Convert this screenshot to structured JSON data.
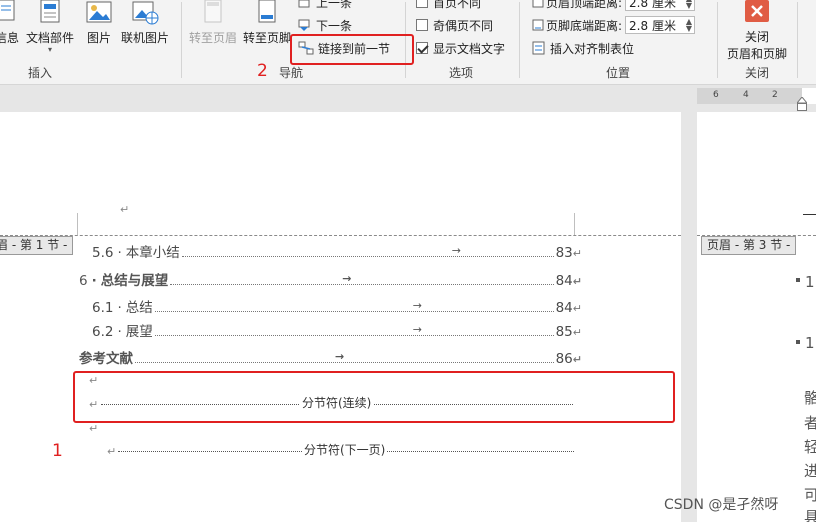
{
  "ribbon": {
    "insert_group": {
      "info_label": "信息",
      "doc_parts_label": "文档部件",
      "picture_label": "图片",
      "online_picture_label": "联机图片",
      "group_label": "插入"
    },
    "nav_group": {
      "goto_header_label": "转至页眉",
      "goto_footer_label": "转至页脚",
      "prev_label": "上一条",
      "next_label": "下一条",
      "link_prev_label": "链接到前一节",
      "group_label": "导航"
    },
    "options_group": {
      "first_page_label": "首页不同",
      "odd_even_label": "奇偶页不同",
      "show_doc_text_label": "显示文档文字",
      "group_label": "选项"
    },
    "position_group": {
      "header_top_label": "页眉顶端距离:",
      "header_top_value": "2.8 厘米",
      "footer_bottom_label": "页脚底端距离:",
      "footer_bottom_value": "2.8 厘米",
      "insert_align_tab_label": "插入对齐制表位",
      "group_label": "位置"
    },
    "close_group": {
      "close_label_line1": "关闭",
      "close_label_line2": "页眉和页脚",
      "group_label": "关闭"
    }
  },
  "ruler": {
    "ticks": [
      "6",
      "4",
      "2"
    ]
  },
  "left_page": {
    "header_tag": "页眉 - 第 1 节 -",
    "toc": [
      {
        "num": "5.6",
        "title": "本章小结",
        "page": "83"
      },
      {
        "num": "6",
        "title": "总结与展望",
        "page": "84"
      },
      {
        "num": "6.1",
        "title": "总结",
        "page": "84"
      },
      {
        "num": "6.2",
        "title": "展望",
        "page": "85"
      },
      {
        "num": "",
        "title": "参考文献",
        "page": "86"
      }
    ],
    "section_break_continuous": "分节符(连续)",
    "section_break_next_page": "分节符(下一页)"
  },
  "right_page": {
    "header_tag": "页眉 - 第 3 节 -",
    "line1": "1",
    "line2": "1.",
    "chars": [
      "骼",
      "者",
      "轻",
      "进",
      "可",
      "具"
    ]
  },
  "annotations": {
    "mark1": "1",
    "mark2": "2"
  },
  "watermark": "CSDN @是孑然呀",
  "colors": {
    "annotation_red": "#e02020",
    "close_button_red": "#e05c44"
  }
}
